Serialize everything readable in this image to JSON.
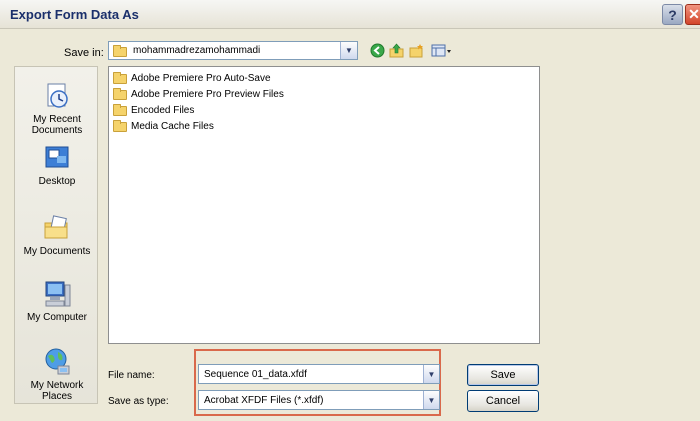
{
  "window": {
    "title": "Export Form Data As"
  },
  "save_in": {
    "label": "Save in:",
    "value": "mohammadrezamohammadi"
  },
  "toolbar": {
    "icons": [
      "back-icon",
      "up-folder-icon",
      "new-folder-icon",
      "view-menu-icon"
    ]
  },
  "places": [
    {
      "label": "My Recent Documents"
    },
    {
      "label": "Desktop"
    },
    {
      "label": "My Documents"
    },
    {
      "label": "My Computer"
    },
    {
      "label": "My Network Places"
    }
  ],
  "files": [
    {
      "name": "Adobe Premiere Pro Auto-Save"
    },
    {
      "name": "Adobe Premiere Pro Preview Files"
    },
    {
      "name": "Encoded Files"
    },
    {
      "name": "Media Cache Files"
    }
  ],
  "file_name": {
    "label": "File name:",
    "value": "Sequence 01_data.xfdf"
  },
  "save_as_type": {
    "label": "Save as type:",
    "value": "Acrobat XFDF Files (*.xfdf)"
  },
  "buttons": {
    "save": "Save",
    "cancel": "Cancel"
  },
  "colors": {
    "highlight_border": "#d9694b",
    "title_text": "#1a2f6b",
    "folder": "#f5d36b"
  }
}
